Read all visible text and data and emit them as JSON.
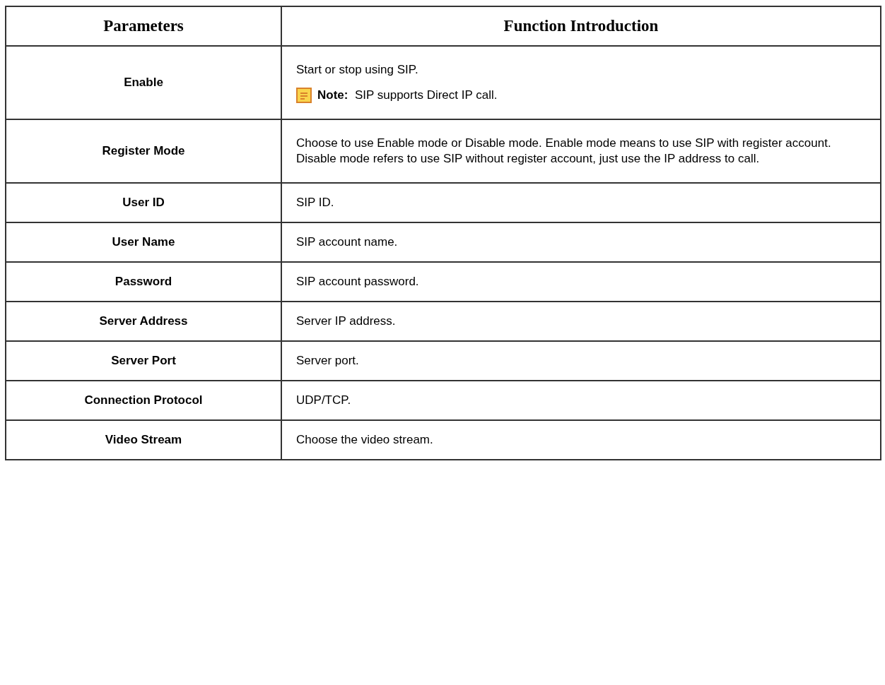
{
  "table": {
    "columns": [
      "Parameters",
      "Function Introduction"
    ],
    "rows": [
      {
        "parameter": "Enable",
        "description": "Start or stop using SIP.",
        "note": {
          "label": "Note:",
          "text": "SIP supports Direct IP call."
        }
      },
      {
        "parameter": "Register Mode",
        "description": "Choose to use Enable mode or Disable mode. Enable mode means to use SIP with register account. Disable mode refers to use SIP without register account, just use the IP address to call."
      },
      {
        "parameter": "User ID",
        "description": "SIP ID."
      },
      {
        "parameter": "User Name",
        "description": "SIP account name."
      },
      {
        "parameter": "Password",
        "description": "SIP account password."
      },
      {
        "parameter": "Server Address",
        "description": "Server IP address."
      },
      {
        "parameter": "Server Port",
        "description": "Server port."
      },
      {
        "parameter": "Connection Protocol",
        "description": "UDP/TCP."
      },
      {
        "parameter": "Video Stream",
        "description": "Choose the video stream."
      }
    ]
  }
}
